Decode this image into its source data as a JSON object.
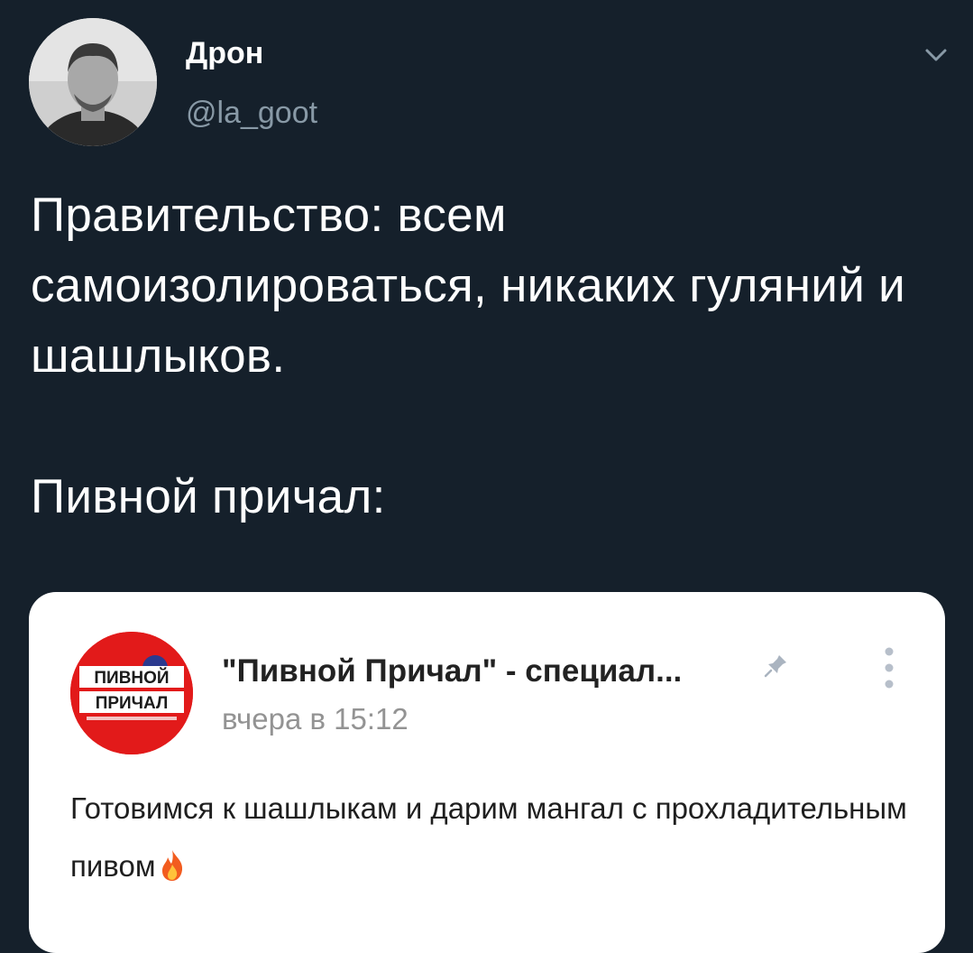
{
  "tweet": {
    "author_name": "Дрон",
    "author_handle": "@la_goot",
    "paragraphs": [
      "Правительство: всем самоизолироваться, никаких гуляний и шашлыков.",
      "Пивной причал:"
    ]
  },
  "embedded_post": {
    "logo_lines": [
      "ПИВНОЙ",
      "ПРИЧАЛ"
    ],
    "title": "\"Пивной Причал\" - специал...",
    "timestamp": "вчера в 15:12",
    "text": "Готовимся к шашлыкам и дарим мангал с прохладительным пивом",
    "icons": [
      "pin-icon",
      "more-vertical-icon",
      "fire-icon"
    ]
  },
  "colors": {
    "background": "#15202b",
    "secondary_text": "#8899a6",
    "card_background": "#ffffff",
    "logo_red": "#e21a1a"
  }
}
